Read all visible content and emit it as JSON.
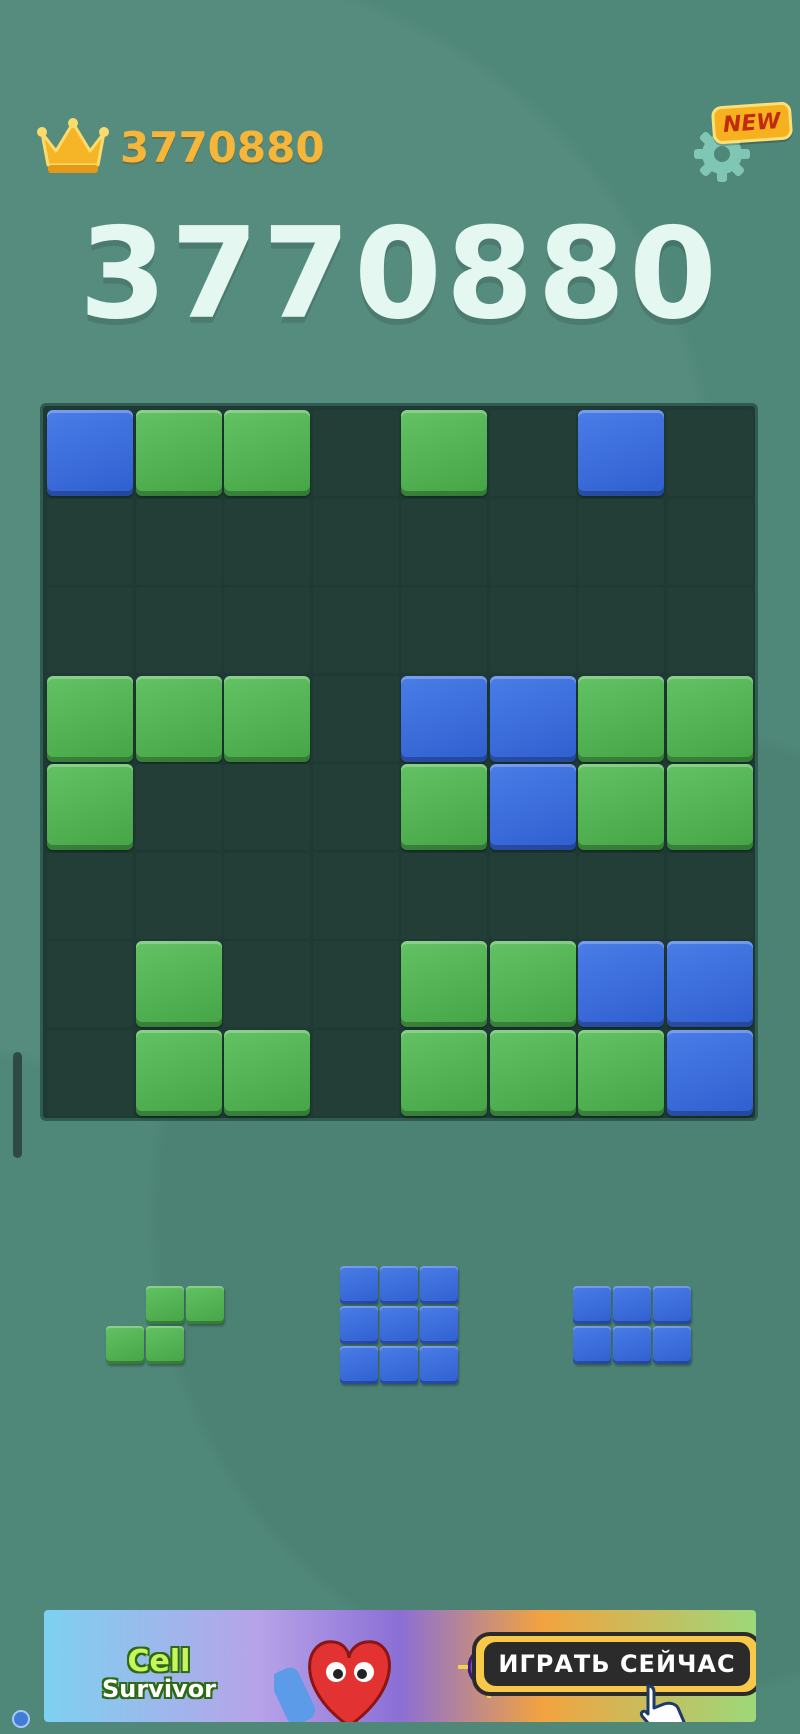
{
  "header": {
    "best_score": "3770880",
    "current_score": "3770880",
    "new_badge": "NEW",
    "crown_icon": "crown-icon",
    "settings_icon": "gear-icon"
  },
  "colors": {
    "green_block": "#4fb152",
    "blue_block": "#3a6ee0",
    "board_bg": "#1f3a34",
    "background": "#4f8779",
    "best_score_text": "#f5b63a",
    "score_text": "#e4f7f0"
  },
  "board": {
    "size": 8,
    "legend": "g = green block, b = blue block, . = empty",
    "rows": [
      "bgg.g.b.",
      "........",
      "........",
      "ggg.bbgg",
      "g...gbgg",
      "........",
      ".g..ggbb",
      ".gg.gggb"
    ]
  },
  "pieces": [
    {
      "color": "g",
      "shape": [
        ".gg",
        "gg."
      ]
    },
    {
      "color": "b",
      "shape": [
        "bbb",
        "bbb",
        "bbb"
      ]
    },
    {
      "color": "b",
      "shape": [
        "bbb",
        "bbb"
      ]
    }
  ],
  "ad": {
    "logo_line1": "Cell",
    "logo_line2": "Survivor",
    "cta_label": "ИГРАТЬ СЕЙЧАС"
  }
}
